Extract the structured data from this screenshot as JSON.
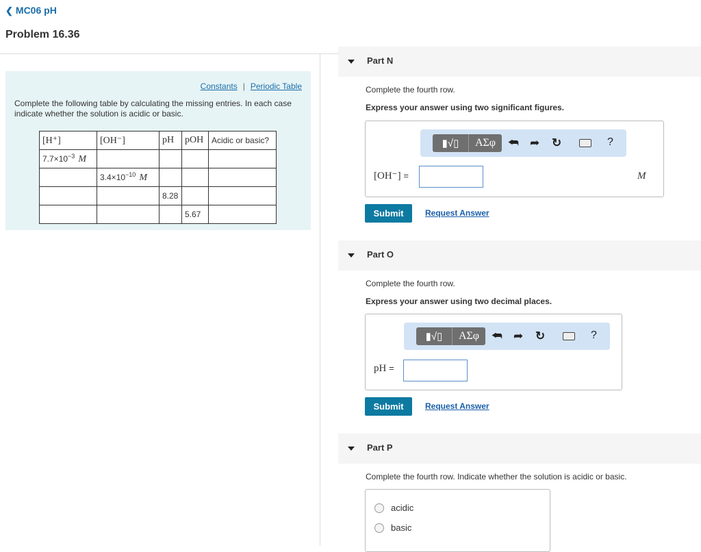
{
  "header": {
    "back_label": "MC06 pH",
    "title": "Problem 16.36"
  },
  "problem": {
    "links": {
      "constants": "Constants",
      "separator": "|",
      "periodic_table": "Periodic Table"
    },
    "instructions": "Complete the following table by calculating the missing entries. In each case indicate whether the solution is acidic or basic.",
    "table": {
      "headers": [
        "[H⁺]",
        "[OH⁻]",
        "pH",
        "pOH",
        "Acidic or basic?"
      ],
      "rows": [
        {
          "h_mantissa": "7.7×10",
          "h_exp": "−3",
          "h_unit": "M",
          "oh_mantissa": "",
          "oh_exp": "",
          "oh_unit": "",
          "ph": "",
          "poh": "",
          "ab": ""
        },
        {
          "h_mantissa": "",
          "h_exp": "",
          "h_unit": "",
          "oh_mantissa": "3.4×10",
          "oh_exp": "−10",
          "oh_unit": "M",
          "ph": "",
          "poh": "",
          "ab": ""
        },
        {
          "h_mantissa": "",
          "h_exp": "",
          "h_unit": "",
          "oh_mantissa": "",
          "oh_exp": "",
          "oh_unit": "",
          "ph": "8.28",
          "poh": "",
          "ab": ""
        },
        {
          "h_mantissa": "",
          "h_exp": "",
          "h_unit": "",
          "oh_mantissa": "",
          "oh_exp": "",
          "oh_unit": "",
          "ph": "",
          "poh": "5.67",
          "ab": ""
        }
      ]
    }
  },
  "parts": {
    "n": {
      "name": "Part N",
      "question": "Complete the fourth row.",
      "instruction": "Express your answer using two significant figures.",
      "toolbar": {
        "templates": "▮√▯",
        "greek": "ΑΣφ",
        "help": "?"
      },
      "label": "[OH⁻]",
      "equals": "=",
      "unit": "M",
      "input_value": "",
      "submit": "Submit",
      "request": "Request Answer"
    },
    "o": {
      "name": "Part O",
      "question": "Complete the fourth row.",
      "instruction": "Express your answer using two decimal places.",
      "toolbar": {
        "templates": "▮√▯",
        "greek": "ΑΣφ",
        "help": "?"
      },
      "label": "pH",
      "equals": "=",
      "input_value": "",
      "submit": "Submit",
      "request": "Request Answer"
    },
    "p": {
      "name": "Part P",
      "question": "Complete the fourth row. Indicate whether the solution is acidic or basic.",
      "options": [
        "acidic",
        "basic"
      ]
    }
  },
  "icons": {
    "back": "chevron-left-icon",
    "collapse": "caret-down-icon",
    "undo": "undo-icon",
    "redo": "redo-icon",
    "reset": "reset-icon",
    "keyboard": "keyboard-icon",
    "help": "help-icon"
  },
  "colors": {
    "accent": "#0d7aa1",
    "link": "#1a6ea8",
    "problem_bg": "#e7f4f6",
    "toolbar_bg": "#d2e3f5"
  }
}
